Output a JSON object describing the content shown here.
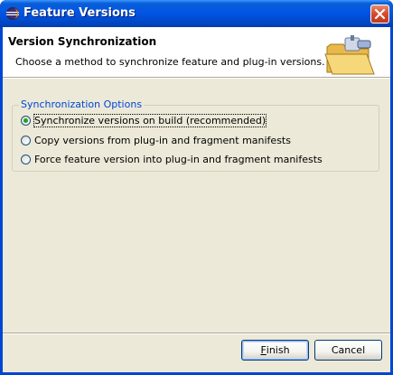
{
  "window": {
    "title": "Feature Versions"
  },
  "header": {
    "title": "Version Synchronization",
    "description": "Choose a method to synchronize feature and plug-in versions."
  },
  "group": {
    "label": "Synchronization Options",
    "options": [
      {
        "label": "Synchronize versions on build (recommended)",
        "checked": true
      },
      {
        "label": "Copy versions from plug-in and fragment manifests",
        "checked": false
      },
      {
        "label": "Force feature version into plug-in and fragment manifests",
        "checked": false
      }
    ]
  },
  "buttons": {
    "finish_mnemonic": "F",
    "finish_rest": "inish",
    "cancel": "Cancel"
  },
  "colors": {
    "titlebar": "#0054e3",
    "group_label": "#0046d5",
    "dialog_bg": "#ece9d8"
  }
}
